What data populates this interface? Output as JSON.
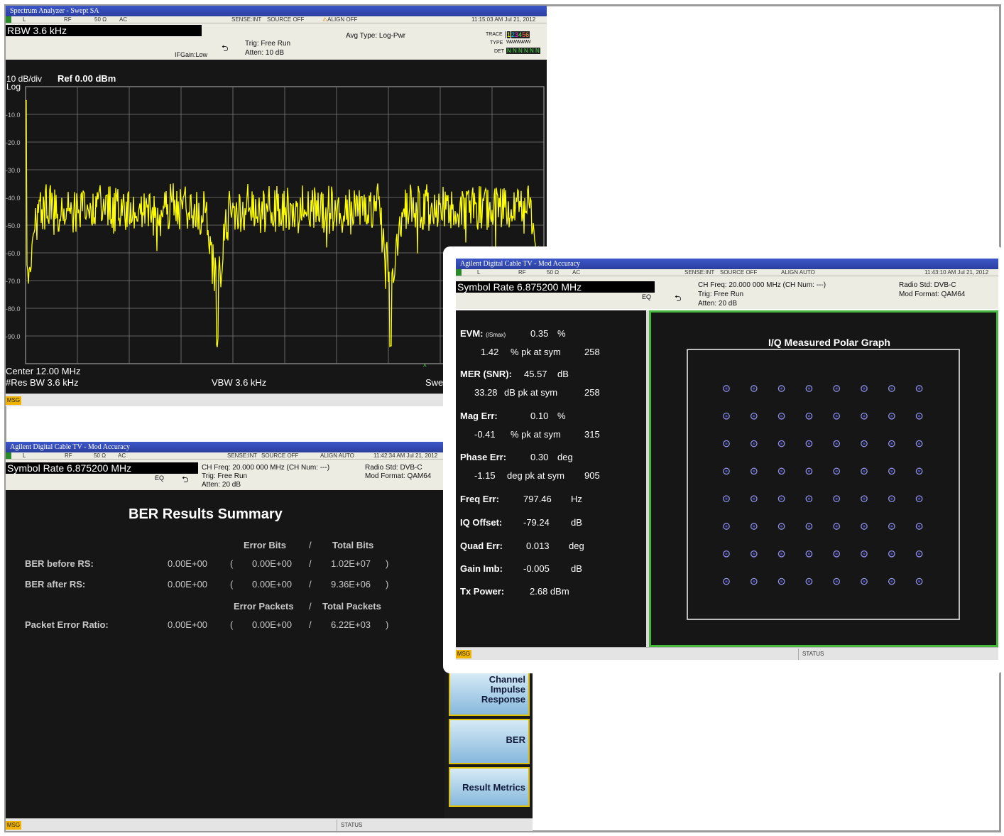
{
  "spectrum": {
    "title": "Spectrum Analyzer - Swept SA",
    "status": {
      "l": "L",
      "rf": "RF",
      "ohm": "50 Ω",
      "ac": "AC",
      "sense": "SENSE:INT",
      "source": "SOURCE OFF",
      "align": "ALIGN OFF",
      "time": "11:15:03 AM Jul 21, 2012"
    },
    "rbw": "RBW 3.6 kHz",
    "ifgain": "IFGain:Low",
    "trig": "Trig: Free Run",
    "atten": "Atten: 10 dB",
    "avg_type": "Avg Type: Log-Pwr",
    "trace_label": "TRACE",
    "trace_digits": [
      "1",
      "2",
      "3",
      "4",
      "5",
      "6"
    ],
    "trace_colors": [
      "#ffff00",
      "#00d0ff",
      "#ff40ff",
      "#40ff40",
      "#ff6060",
      "#ffa040"
    ],
    "type_label": "TYPE",
    "type_value": "WWWWWW",
    "det_label": "DET",
    "det_value": "N N N N N N",
    "scale": "10 dB/div",
    "ref": "Ref 0.00 dBm",
    "log": "Log",
    "y_ticks": [
      "-10.0",
      "-20.0",
      "-30.0",
      "-40.0",
      "-50.0",
      "-60.0",
      "-70.0",
      "-80.0",
      "-90.0"
    ],
    "center": "Center 12.00 MHz",
    "res_bw": "#Res BW 3.6 kHz",
    "vbw": "VBW 3.6 kHz",
    "sweep_fragment": "Swe",
    "msg": "MSG",
    "trace_color": "#ffff00"
  },
  "ber": {
    "title": "Agilent Digital Cable TV - Mod Accuracy",
    "status": {
      "l": "L",
      "rf": "RF",
      "ohm": "50 Ω",
      "ac": "AC",
      "sense": "SENSE:INT",
      "source": "SOURCE OFF",
      "align": "ALIGN AUTO",
      "time": "11:42:34 AM Jul 21, 2012"
    },
    "symbol_rate": "Symbol Rate 6.875200 MHz",
    "eq": "EQ",
    "ch_freq": "CH Freq: 20.000 000 MHz (CH Num: ---)",
    "trig": "Trig: Free Run",
    "atten": "Atten: 20 dB",
    "radio_std": "Radio Std: DVB-C",
    "mod_format": "Mod Format: QAM64",
    "heading": "BER Results Summary",
    "col_error_bits": "Error Bits",
    "col_total_bits": "Total Bits",
    "col_error_packets": "Error Packets",
    "col_total_packets": "Total Packets",
    "slash": "/",
    "paren_open": "(",
    "paren_close": ")",
    "rows": [
      {
        "label": "BER before RS:",
        "value": "0.00E+00",
        "errors": "0.00E+00",
        "total": "1.02E+07"
      },
      {
        "label": "BER after RS:",
        "value": "0.00E+00",
        "errors": "0.00E+00",
        "total": "9.36E+06"
      },
      {
        "label": "Packet Error Ratio:",
        "value": "0.00E+00",
        "errors": "0.00E+00",
        "total": "6.22E+03"
      }
    ],
    "msg": "MSG",
    "status_label": "STATUS"
  },
  "softkeys": [
    "Channel\nImpulse\nResponse",
    "BER",
    "Result Metrics"
  ],
  "modacc": {
    "title": "Agilent Digital Cable TV - Mod Accuracy",
    "status": {
      "l": "L",
      "rf": "RF",
      "ohm": "50 Ω",
      "ac": "AC",
      "sense": "SENSE:INT",
      "source": "SOURCE OFF",
      "align": "ALIGN AUTO",
      "time": "11:43:10 AM Jul 21, 2012"
    },
    "symbol_rate": "Symbol Rate 6.875200 MHz",
    "eq": "EQ",
    "ch_freq": "CH Freq: 20.000 000 MHz (CH Num: ---)",
    "trig": "Trig: Free Run",
    "atten": "Atten: 20 dB",
    "radio_std": "Radio Std: DVB-C",
    "mod_format": "Mod Format: QAM64",
    "metrics": {
      "evm_label": "EVM:",
      "evm_sub": "(/Smax)",
      "evm_value": "0.35",
      "evm_unit": "%",
      "evm_pk": "1.42",
      "evm_pk_unit": "% pk at sym",
      "evm_sym": "258",
      "mer_label": "MER (SNR):",
      "mer_value": "45.57",
      "mer_unit": "dB",
      "mer_pk": "33.28",
      "mer_pk_unit": "dB pk at sym",
      "mer_sym": "258",
      "mag_label": "Mag Err:",
      "mag_value": "0.10",
      "mag_unit": "%",
      "mag_pk": "-0.41",
      "mag_pk_unit": "% pk at sym",
      "mag_sym": "315",
      "phase_label": "Phase Err:",
      "phase_value": "0.30",
      "phase_unit": "deg",
      "phase_pk": "-1.15",
      "phase_pk_unit": "deg pk at sym",
      "phase_sym": "905",
      "freq_label": "Freq Err:",
      "freq_value": "797.46",
      "freq_unit": "Hz",
      "iq_label": "IQ Offset:",
      "iq_value": "-79.24",
      "iq_unit": "dB",
      "quad_label": "Quad Err:",
      "quad_value": "0.013",
      "quad_unit": "deg",
      "gain_label": "Gain Imb:",
      "gain_value": "-0.005",
      "gain_unit": "dB",
      "tx_label": "Tx Power:",
      "tx_value": "2.68 dBm"
    },
    "graph_title": "I/Q Measured Polar Graph",
    "constellation": "QAM64",
    "msg": "MSG",
    "status_label": "STATUS"
  }
}
